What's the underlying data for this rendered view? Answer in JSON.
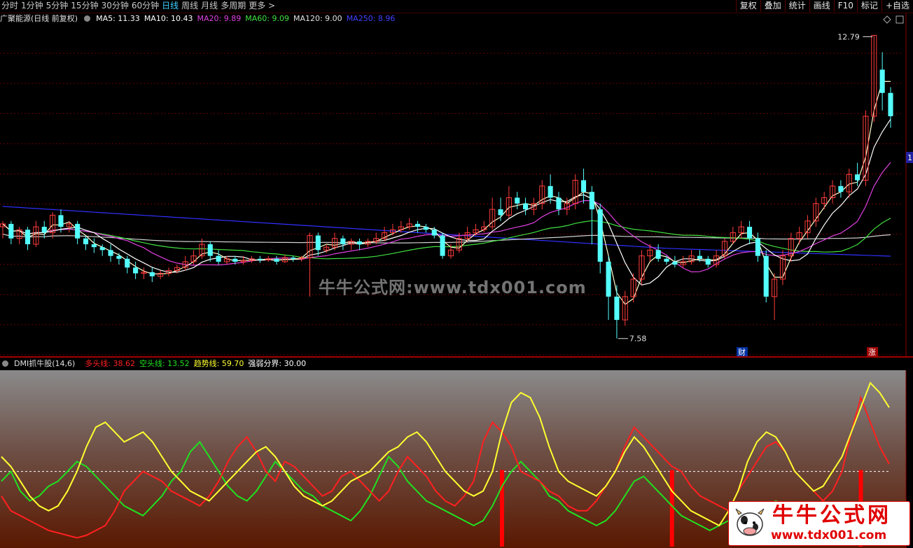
{
  "toolbar": {
    "periods": [
      "分时",
      "1分钟",
      "5分钟",
      "15分钟",
      "30分钟",
      "60分钟",
      "日线",
      "周线",
      "月线",
      "多周期",
      "更多 >"
    ],
    "active_period": "日线",
    "right_buttons": [
      "复权",
      "叠加",
      "统计",
      "画线",
      "F10",
      "标记",
      "+自选"
    ]
  },
  "price_panel": {
    "stock_title": "广聚能源(日线 前复权)",
    "ma_legend": [
      {
        "label": "MA5: 11.33",
        "color": "#ffffff"
      },
      {
        "label": "MA10: 10.43",
        "color": "#ffffff"
      },
      {
        "label": "MA20: 9.89",
        "color": "#e040e0"
      },
      {
        "label": "MA60: 9.09",
        "color": "#40e040"
      },
      {
        "label": "MA120: 9.00",
        "color": "#e0e0e0"
      },
      {
        "label": "MA250: 8.96",
        "color": "#4040ff"
      }
    ],
    "high_label": "12.79",
    "low_label": "7.58",
    "marker_cai": "财",
    "marker_zhang": "涨",
    "side_tag": "1",
    "watermark": "牛牛公式网:www.tdx001.com"
  },
  "indicator_panel": {
    "name": "DMI抓牛股(14,6)",
    "legend": [
      {
        "label": "多头线: 38.62",
        "color": "#ff2020"
      },
      {
        "label": "空头线: 13.52",
        "color": "#20e020"
      },
      {
        "label": "趋势线: 59.70",
        "color": "#ffff30"
      },
      {
        "label": "强弱分界: 30.00",
        "color": "#ffffff"
      }
    ]
  },
  "brand": {
    "title": "牛牛公式网",
    "url": "www.tdx001.com"
  },
  "colors": {
    "up": "#ff3c3c",
    "down": "#54ffff",
    "grid": "#6a0000",
    "bg": "#000000"
  },
  "chart_data": {
    "type": "candlestick",
    "ylim": [
      7.3,
      13.0
    ],
    "candles": [
      [
        9.5,
        9.55,
        9.3,
        9.6
      ],
      [
        9.55,
        9.3,
        9.2,
        9.6
      ],
      [
        9.3,
        9.45,
        9.2,
        9.5
      ],
      [
        9.45,
        9.2,
        9.1,
        9.5
      ],
      [
        9.2,
        9.5,
        9.15,
        9.6
      ],
      [
        9.5,
        9.4,
        9.3,
        9.6
      ],
      [
        9.4,
        9.7,
        9.3,
        9.75
      ],
      [
        9.7,
        9.5,
        9.4,
        9.8
      ],
      [
        9.5,
        9.55,
        9.4,
        9.6
      ],
      [
        9.55,
        9.3,
        9.2,
        9.6
      ],
      [
        9.3,
        9.2,
        9.1,
        9.35
      ],
      [
        9.2,
        9.15,
        9.05,
        9.3
      ],
      [
        9.15,
        9.1,
        9.0,
        9.2
      ],
      [
        9.1,
        9.0,
        8.9,
        9.2
      ],
      [
        9.0,
        8.95,
        8.85,
        9.05
      ],
      [
        8.95,
        8.8,
        8.7,
        9.0
      ],
      [
        8.8,
        8.7,
        8.6,
        8.9
      ],
      [
        8.7,
        8.72,
        8.6,
        8.8
      ],
      [
        8.72,
        8.65,
        8.55,
        8.8
      ],
      [
        8.65,
        8.7,
        8.6,
        8.75
      ],
      [
        8.7,
        8.75,
        8.65,
        8.8
      ],
      [
        8.75,
        8.8,
        8.7,
        8.85
      ],
      [
        8.8,
        8.9,
        8.75,
        9.0
      ],
      [
        8.9,
        9.0,
        8.85,
        9.1
      ],
      [
        9.0,
        9.2,
        8.95,
        9.3
      ],
      [
        9.2,
        9.0,
        8.9,
        9.25
      ],
      [
        9.0,
        8.9,
        8.85,
        9.1
      ],
      [
        8.9,
        8.95,
        8.85,
        9.0
      ],
      [
        8.95,
        8.9,
        8.85,
        9.0
      ],
      [
        8.9,
        8.92,
        8.85,
        9.0
      ],
      [
        8.92,
        8.95,
        8.88,
        9.0
      ],
      [
        8.95,
        8.93,
        8.88,
        9.0
      ],
      [
        8.93,
        8.95,
        8.9,
        9.0
      ],
      [
        8.95,
        8.9,
        8.85,
        9.0
      ],
      [
        8.9,
        8.97,
        8.88,
        9.02
      ],
      [
        8.97,
        8.95,
        8.9,
        9.0
      ],
      [
        8.95,
        8.97,
        8.9,
        9.0
      ],
      [
        8.97,
        9.35,
        8.3,
        9.4
      ],
      [
        9.35,
        9.1,
        9.0,
        9.4
      ],
      [
        9.1,
        9.15,
        9.05,
        9.2
      ],
      [
        9.15,
        9.3,
        9.1,
        9.4
      ],
      [
        9.3,
        9.2,
        9.1,
        9.35
      ],
      [
        9.2,
        9.25,
        9.1,
        9.3
      ],
      [
        9.25,
        9.2,
        9.1,
        9.3
      ],
      [
        9.2,
        9.25,
        9.15,
        9.3
      ],
      [
        9.25,
        9.3,
        9.2,
        9.4
      ],
      [
        9.3,
        9.4,
        9.25,
        9.5
      ],
      [
        9.4,
        9.45,
        9.35,
        9.55
      ],
      [
        9.45,
        9.5,
        9.4,
        9.6
      ],
      [
        9.5,
        9.55,
        9.45,
        9.65
      ],
      [
        9.55,
        9.5,
        9.4,
        9.6
      ],
      [
        9.5,
        9.45,
        9.4,
        9.55
      ],
      [
        9.45,
        9.35,
        9.3,
        9.5
      ],
      [
        9.35,
        9.0,
        8.95,
        9.4
      ],
      [
        9.0,
        9.1,
        8.95,
        9.2
      ],
      [
        9.1,
        9.3,
        9.05,
        9.4
      ],
      [
        9.3,
        9.4,
        9.25,
        9.5
      ],
      [
        9.4,
        9.45,
        9.35,
        9.55
      ],
      [
        9.45,
        9.5,
        9.4,
        9.6
      ],
      [
        9.5,
        9.8,
        9.45,
        10.0
      ],
      [
        9.8,
        9.7,
        9.6,
        10.0
      ],
      [
        9.7,
        10.0,
        9.65,
        10.2
      ],
      [
        10.0,
        9.9,
        9.8,
        10.1
      ],
      [
        9.9,
        9.8,
        9.7,
        10.0
      ],
      [
        9.8,
        9.9,
        9.7,
        10.0
      ],
      [
        9.9,
        10.2,
        9.8,
        10.3
      ],
      [
        10.2,
        10.0,
        9.9,
        10.4
      ],
      [
        10.0,
        9.8,
        9.7,
        10.1
      ],
      [
        9.8,
        9.9,
        9.7,
        10.0
      ],
      [
        9.9,
        10.3,
        9.8,
        10.4
      ],
      [
        10.3,
        10.1,
        9.9,
        10.5
      ],
      [
        10.1,
        9.8,
        9.2,
        10.2
      ],
      [
        9.8,
        8.9,
        8.7,
        9.9
      ],
      [
        8.9,
        8.3,
        7.9,
        9.0
      ],
      [
        8.3,
        7.9,
        7.58,
        8.5
      ],
      [
        7.9,
        8.3,
        7.8,
        8.4
      ],
      [
        8.3,
        8.6,
        8.2,
        8.7
      ],
      [
        8.6,
        9.0,
        8.5,
        9.1
      ],
      [
        9.0,
        9.1,
        8.9,
        9.2
      ],
      [
        9.1,
        8.95,
        8.9,
        9.2
      ],
      [
        8.95,
        8.9,
        8.85,
        9.0
      ],
      [
        8.9,
        8.85,
        8.8,
        9.0
      ],
      [
        8.85,
        8.9,
        8.8,
        9.0
      ],
      [
        8.9,
        9.0,
        8.85,
        9.1
      ],
      [
        9.0,
        8.95,
        8.9,
        9.1
      ],
      [
        8.95,
        8.85,
        8.8,
        9.0
      ],
      [
        8.85,
        9.0,
        8.8,
        9.1
      ],
      [
        9.0,
        9.25,
        8.95,
        9.3
      ],
      [
        9.25,
        9.4,
        9.2,
        9.5
      ],
      [
        9.4,
        9.5,
        9.3,
        9.6
      ],
      [
        9.5,
        9.3,
        9.2,
        9.6
      ],
      [
        9.3,
        9.0,
        8.9,
        9.4
      ],
      [
        9.0,
        8.3,
        8.2,
        9.1
      ],
      [
        8.3,
        8.6,
        7.9,
        8.7
      ],
      [
        8.6,
        9.0,
        8.5,
        9.1
      ],
      [
        9.0,
        9.3,
        8.9,
        9.4
      ],
      [
        9.3,
        9.4,
        9.2,
        9.5
      ],
      [
        9.4,
        9.6,
        9.3,
        9.7
      ],
      [
        9.6,
        9.9,
        9.5,
        10.0
      ],
      [
        9.9,
        10.0,
        9.8,
        10.1
      ],
      [
        10.0,
        10.2,
        9.9,
        10.3
      ],
      [
        10.2,
        10.1,
        10.0,
        10.3
      ],
      [
        10.1,
        10.4,
        10.0,
        10.5
      ],
      [
        10.4,
        10.3,
        10.2,
        10.6
      ],
      [
        10.3,
        11.4,
        10.2,
        11.5
      ],
      [
        11.4,
        12.79,
        11.3,
        12.79
      ],
      [
        12.2,
        11.8,
        11.5,
        12.5
      ],
      [
        11.8,
        11.4,
        11.2,
        11.9
      ]
    ],
    "indicator_series": {
      "ylim": [
        0,
        70
      ],
      "threshold": 30,
      "多头线": [
        20,
        14,
        12,
        10,
        8,
        6,
        5,
        4,
        3,
        4,
        6,
        8,
        14,
        22,
        26,
        30,
        28,
        26,
        22,
        20,
        18,
        16,
        20,
        26,
        34,
        40,
        44,
        38,
        30,
        26,
        34,
        32,
        28,
        24,
        20,
        22,
        28,
        30,
        26,
        22,
        18,
        22,
        30,
        36,
        32,
        28,
        22,
        18,
        16,
        20,
        26,
        42,
        50,
        46,
        40,
        30,
        28,
        26,
        22,
        20,
        16,
        14,
        14,
        18,
        24,
        30,
        40,
        48,
        44,
        40,
        36,
        32,
        30,
        24,
        20,
        18,
        16,
        14,
        22,
        28,
        34,
        40,
        42,
        38,
        30,
        26,
        22,
        18,
        22,
        30,
        46,
        60,
        50,
        40,
        33
      ],
      "空头线": [
        26,
        30,
        22,
        18,
        20,
        24,
        26,
        30,
        34,
        32,
        28,
        24,
        20,
        16,
        14,
        12,
        16,
        20,
        26,
        30,
        38,
        42,
        36,
        30,
        24,
        20,
        18,
        22,
        28,
        34,
        30,
        26,
        22,
        20,
        16,
        14,
        12,
        10,
        14,
        20,
        28,
        36,
        32,
        26,
        22,
        18,
        16,
        14,
        12,
        10,
        8,
        10,
        16,
        24,
        30,
        34,
        30,
        26,
        20,
        18,
        14,
        12,
        10,
        8,
        10,
        14,
        20,
        26,
        28,
        24,
        20,
        16,
        12,
        10,
        8,
        6,
        8,
        10,
        12,
        14,
        16,
        16,
        18,
        16,
        14,
        12,
        10,
        8,
        8,
        10,
        12,
        14,
        16,
        14,
        12
      ],
      "趋势线": [
        36,
        32,
        26,
        20,
        16,
        14,
        16,
        22,
        30,
        40,
        48,
        50,
        46,
        42,
        44,
        46,
        42,
        36,
        30,
        26,
        22,
        20,
        18,
        22,
        26,
        30,
        34,
        38,
        40,
        36,
        30,
        24,
        20,
        18,
        16,
        18,
        22,
        26,
        28,
        30,
        34,
        38,
        40,
        44,
        46,
        42,
        36,
        30,
        26,
        22,
        20,
        22,
        30,
        46,
        58,
        62,
        60,
        52,
        40,
        30,
        26,
        24,
        22,
        20,
        24,
        30,
        38,
        44,
        40,
        34,
        28,
        22,
        18,
        14,
        12,
        10,
        8,
        14,
        22,
        34,
        42,
        46,
        44,
        38,
        30,
        26,
        22,
        24,
        30,
        36,
        46,
        56,
        66,
        62,
        56
      ]
    }
  }
}
